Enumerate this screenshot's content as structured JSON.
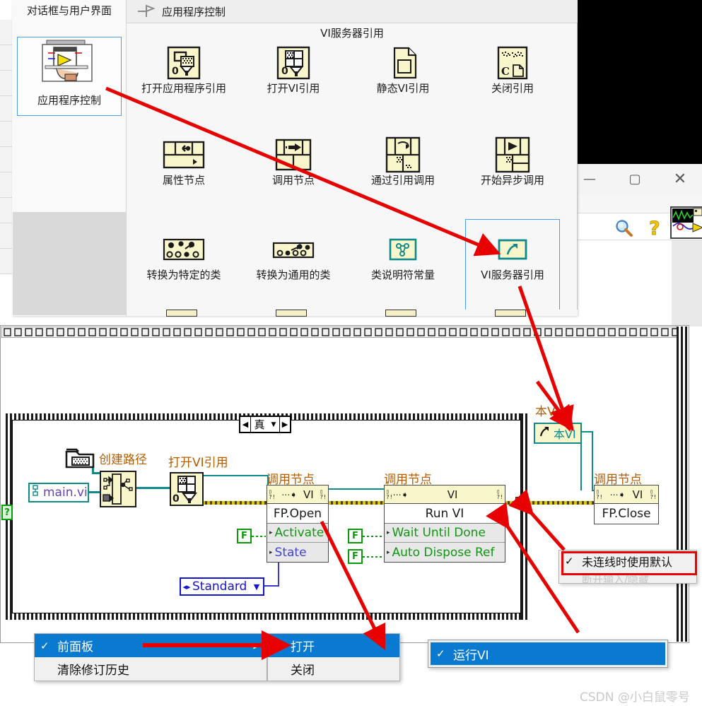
{
  "palette": {
    "category_title": "对话框与用户界面",
    "category_item_label": "应用程序控制",
    "header_title": "应用程序控制",
    "pin_icon": "pin-icon",
    "subtitle": "VI服务器引用",
    "items": [
      {
        "label": "打开应用程序引用",
        "icon": "open-application-reference-icon"
      },
      {
        "label": "打开VI引用",
        "icon": "open-vi-reference-icon"
      },
      {
        "label": "静态VI引用",
        "icon": "static-vi-reference-icon"
      },
      {
        "label": "关闭引用",
        "icon": "close-reference-icon"
      },
      {
        "label": "属性节点",
        "icon": "property-node-icon"
      },
      {
        "label": "调用节点",
        "icon": "invoke-node-icon"
      },
      {
        "label": "通过引用调用",
        "icon": "call-by-reference-icon"
      },
      {
        "label": "开始异步调用",
        "icon": "start-async-call-icon"
      },
      {
        "label": "转换为特定的类",
        "icon": "to-more-specific-class-icon"
      },
      {
        "label": "转换为通用的类",
        "icon": "to-more-generic-class-icon"
      },
      {
        "label": "类说明符常量",
        "icon": "class-specifier-constant-icon"
      },
      {
        "label": "VI服务器引用",
        "icon": "vi-server-reference-icon"
      }
    ],
    "selected_item_label": "VI服务器引用"
  },
  "window": {
    "minimize_glyph": "—",
    "maximize_glyph": "▢",
    "close_glyph": "✕",
    "search_icon": "magnifier-icon",
    "help_icon": "question-mark-icon",
    "vi_thumbnail_icon": "vi-icon"
  },
  "diagram": {
    "case_selector": {
      "left_arrow": "◀",
      "value": "真",
      "dropdown": "▼",
      "right_arrow": "▶"
    },
    "case_terminal": "?",
    "constants": {
      "main_vi_path": "main.vi",
      "folder_icon": "folder-path-icon"
    },
    "labels": {
      "build_path": "创建路径",
      "open_vi_reference": "打开VI引用",
      "invoke_node_1": "调用节点",
      "invoke_node_2": "调用节点",
      "invoke_node_3": "调用节点",
      "this_vi": "本VI"
    },
    "invoke_nodes": [
      {
        "header_class": "VI",
        "method": "FP.Open",
        "params": [
          {
            "name": "Activate",
            "color": "green"
          },
          {
            "name": "State",
            "color": "blue"
          }
        ]
      },
      {
        "header_class": "VI",
        "method": "Run VI",
        "params": [
          {
            "name": "Wait Until Done",
            "color": "green"
          },
          {
            "name": "Auto Dispose Ref",
            "color": "green"
          }
        ]
      },
      {
        "header_class": "VI",
        "method": "FP.Close",
        "params": []
      }
    ],
    "boolean_constants": [
      "F",
      "F",
      "F"
    ],
    "enum_standard": {
      "left_right": "◂▸",
      "value": "Standard",
      "dropdown": "▼"
    },
    "this_vi_reference": {
      "icon": "vi-server-reference-icon",
      "label": "本VI"
    }
  },
  "menus": {
    "front_panel_menu": {
      "items": [
        {
          "label": "前面板",
          "checked": "✓",
          "selected": true,
          "has_submenu": "▶"
        },
        {
          "label": "清除修订历史",
          "checked": "",
          "selected": false,
          "has_submenu": ""
        }
      ]
    },
    "submenu": {
      "items": [
        {
          "label": "打开",
          "checked": "✓",
          "selected": true
        },
        {
          "label": "关闭",
          "checked": "",
          "selected": false
        }
      ]
    },
    "run_vi_menu": {
      "items": [
        {
          "label": "运行VI",
          "checked": "✓",
          "selected": true
        }
      ]
    },
    "default_menu": {
      "items": [
        {
          "label": "未连线时使用默认",
          "checked": "✓"
        }
      ],
      "ghost_label": "断开输入/隐藏"
    }
  },
  "watermark": "CSDN @小白鼠零号",
  "colors": {
    "accent_blue": "#4a9eea",
    "annotation_red": "#e60000",
    "labview_yellow": "#faf6cc",
    "teal_wire": "#0e8a8a",
    "selection_blue": "#0a7ad0",
    "error_wire": "#d8c400"
  }
}
